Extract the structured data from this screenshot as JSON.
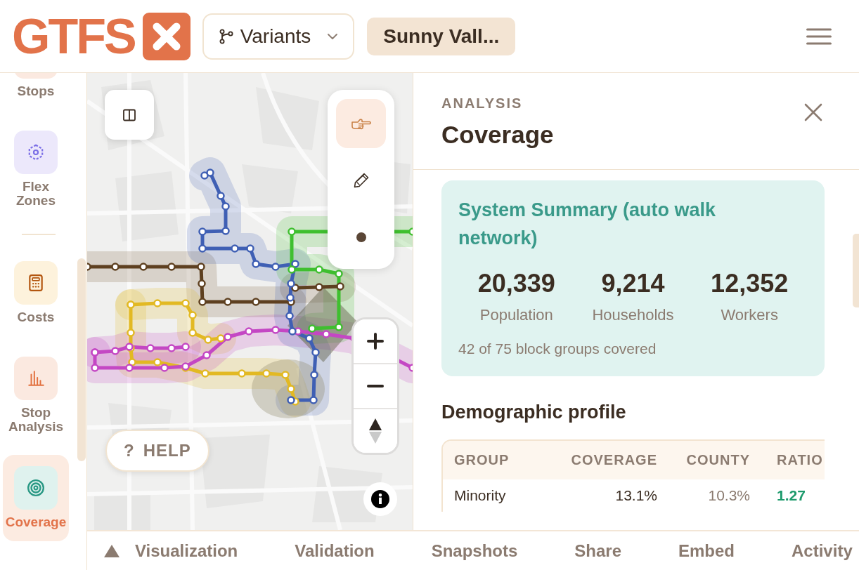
{
  "header": {
    "logo_text": "GTFS",
    "variants_button": {
      "label": "Variants"
    },
    "project_button": {
      "label": "Sunny Vall..."
    }
  },
  "sidebar": {
    "groups": [
      {
        "items": [
          {
            "label": "Stops",
            "selected": false
          },
          {
            "label": "Flex Zones",
            "kind": "flex",
            "selected": false
          }
        ]
      },
      {
        "items": [
          {
            "label": "Costs",
            "kind": "costs",
            "selected": false
          },
          {
            "label": "Stop Analysis",
            "kind": "analysis",
            "selected": false
          },
          {
            "label": "Coverage",
            "kind": "coverage",
            "selected": true
          }
        ]
      }
    ]
  },
  "map": {
    "tools": [
      {
        "kind": "pointer",
        "selected": true
      },
      {
        "kind": "pencil",
        "selected": false
      },
      {
        "kind": "point",
        "selected": false
      }
    ],
    "help_button": {
      "glyph": "?",
      "label": "HELP"
    }
  },
  "panel": {
    "eyebrow": "ANALYSIS",
    "title": "Coverage",
    "summary": {
      "title": "System Summary (auto walk network)",
      "stats": [
        {
          "value": "20,339",
          "label": "Population"
        },
        {
          "value": "9,214",
          "label": "Households"
        },
        {
          "value": "12,352",
          "label": "Workers"
        }
      ],
      "note": "42 of 75 block groups covered"
    },
    "section_title": "Demographic profile",
    "table": {
      "columns": [
        "GROUP",
        "COVERAGE",
        "COUNTY",
        "RATIO"
      ],
      "rows": [
        [
          "Minority",
          "13.1%",
          "10.3%",
          "1.27"
        ]
      ]
    }
  },
  "drawer": {
    "tabs": [
      {
        "label": "Visualization",
        "selected": false
      },
      {
        "label": "Validation",
        "selected": false
      },
      {
        "label": "Snapshots",
        "selected": false
      },
      {
        "label": "Share",
        "selected": false
      },
      {
        "label": "Embed",
        "selected": false
      },
      {
        "label": "Activity",
        "selected": false
      }
    ]
  }
}
